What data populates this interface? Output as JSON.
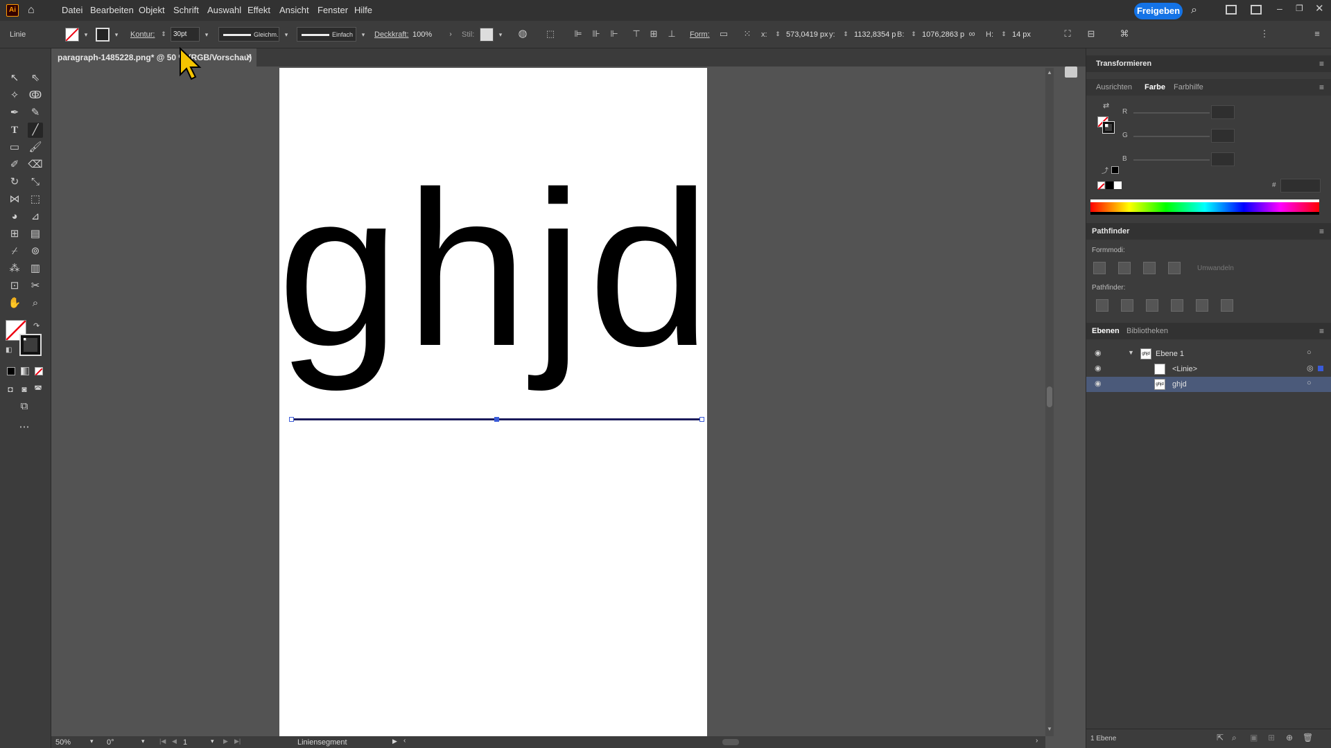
{
  "menubar": {
    "logo": "Ai",
    "items": [
      "Datei",
      "Bearbeiten",
      "Objekt",
      "Schrift",
      "Auswahl",
      "Effekt",
      "Ansicht",
      "Fenster",
      "Hilfe"
    ],
    "share_label": "Freigeben"
  },
  "controlbar": {
    "object_type": "Linie",
    "stroke_label": "Kontur:",
    "stroke_value": "30pt",
    "profile_label": "Gleichm.",
    "brush_label": "Einfach",
    "opacity_label": "Deckkraft:",
    "opacity_value": "100%",
    "style_label": "Stil:",
    "shape_label": "Form:",
    "x_label": "x:",
    "x_value": "573,0419 px",
    "y_label": "y:",
    "y_value": "1132,8354 p",
    "w_label": "B:",
    "w_value": "1076,2863 p",
    "h_label": "H:",
    "h_value": "14 px"
  },
  "document": {
    "tab_title": "paragraph-1485228.png* @ 50 % (RGB/Vorschau)",
    "canvas_text": "ghjd"
  },
  "statusbar": {
    "zoom": "50%",
    "rotation": "0°",
    "page": "1",
    "tool_info": "Liniensegment"
  },
  "panels": {
    "transform_title": "Transformieren",
    "color_tabs": [
      "Ausrichten",
      "Farbe",
      "Farbhilfe"
    ],
    "channels": [
      "R",
      "G",
      "B"
    ],
    "hex_prefix": "#",
    "pathfinder_title": "Pathfinder",
    "shape_modes_label": "Formmodi:",
    "expand_label": "Umwandeln",
    "pathfinder_label": "Pathfinder:",
    "layers_tabs": [
      "Ebenen",
      "Bibliotheken"
    ],
    "layers": [
      {
        "name": "Ebene 1",
        "thumb": "ghjd"
      },
      {
        "name": "<Linie>",
        "thumb": ""
      },
      {
        "name": "ghjd",
        "thumb": "ghjd"
      }
    ],
    "layer_count": "1 Ebene"
  },
  "colors": {
    "accent": "#1473e6",
    "selection": "#3a5bd9",
    "selected_layer_bg": "#4b5a7a"
  }
}
